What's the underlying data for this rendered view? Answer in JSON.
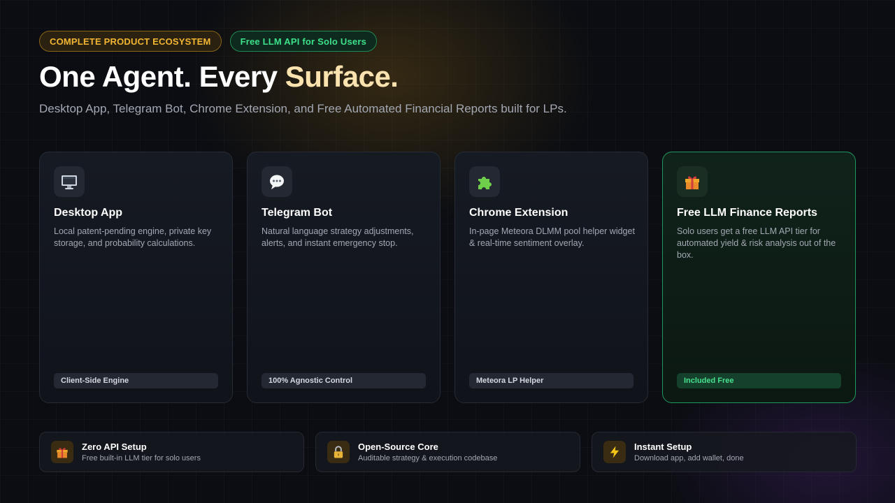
{
  "badges": {
    "ecosystem": "COMPLETE PRODUCT ECOSYSTEM",
    "free_api": "Free LLM API for Solo Users"
  },
  "hero": {
    "title_main": "One Agent. Every ",
    "title_accent": "Surface.",
    "subtitle": "Desktop App, Telegram Bot, Chrome Extension, and Free Automated Financial Reports built for LPs."
  },
  "cards": [
    {
      "icon": "desktop-monitor-icon",
      "title": "Desktop App",
      "description": "Local patent-pending engine, private key storage, and probability calculations.",
      "tag": "Client-Side Engine"
    },
    {
      "icon": "speech-bubble-icon",
      "title": "Telegram Bot",
      "description": "Natural language strategy adjustments, alerts, and instant emergency stop.",
      "tag": "100% Agnostic Control"
    },
    {
      "icon": "puzzle-piece-icon",
      "title": "Chrome Extension",
      "description": "In-page Meteora DLMM pool helper widget & real-time sentiment overlay.",
      "tag": "Meteora LP Helper"
    },
    {
      "icon": "gift-icon",
      "title": "Free LLM Finance Reports",
      "description": "Solo users get a free LLM API tier for automated yield & risk analysis out of the box.",
      "tag": "Included Free"
    }
  ],
  "features": [
    {
      "icon": "gift-icon",
      "title": "Zero API Setup",
      "subtitle": "Free built-in LLM tier for solo users"
    },
    {
      "icon": "lock-icon",
      "title": "Open-Source Core",
      "subtitle": "Auditable strategy & execution codebase"
    },
    {
      "icon": "lightning-icon",
      "title": "Instant Setup",
      "subtitle": "Download app, add wallet, done"
    }
  ],
  "colors": {
    "background": "#0b0d12",
    "amber_accent": "#f2b632",
    "green_accent": "#3de08a",
    "title_accent": "#fbe3b0"
  }
}
